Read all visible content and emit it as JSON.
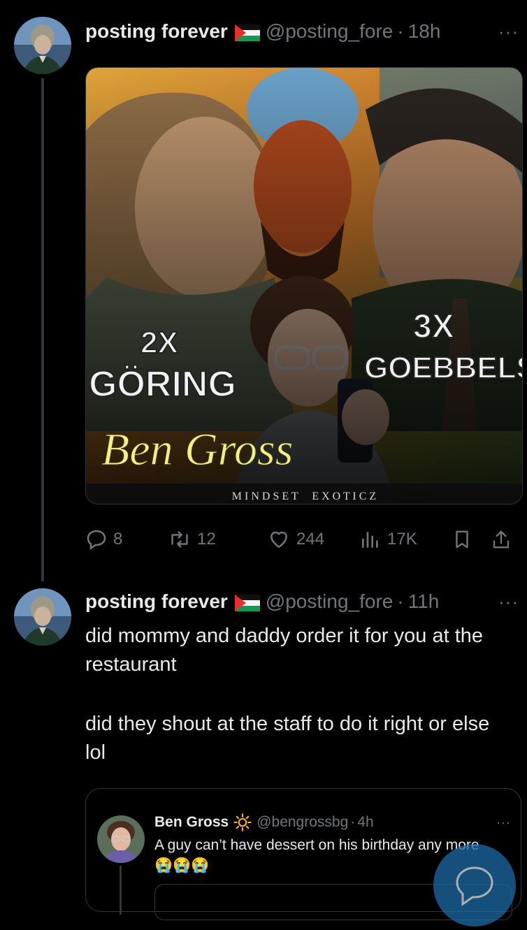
{
  "tweet1": {
    "author_name": "posting forever",
    "handle": "@posting_fore",
    "time": "18h",
    "more": "···",
    "image": {
      "label_left_count": "2X",
      "label_left_name": "GÖRING",
      "label_right_count": "3X",
      "label_right_name": "GOEBBELS",
      "script_title": "Ben Gross",
      "subtitle": "M I N D S E T     E X O T I C Z"
    },
    "actions": {
      "replies": "8",
      "reposts": "12",
      "likes": "244",
      "views": "17K"
    }
  },
  "tweet2": {
    "author_name": "posting forever",
    "handle": "@posting_fore",
    "time": "11h",
    "more": "···",
    "text_p1": "did mommy and daddy order it for you at the restaurant",
    "text_p2": "did they shout at the staff to do it right or else lol",
    "quote": {
      "author_name": "Ben Gross",
      "badge_icon": "sun-icon",
      "handle": "@bengrossbg",
      "time": "4h",
      "more": "···",
      "text": "A guy can’t have dessert on his birthday any more",
      "emoji": "😭😭😭"
    }
  },
  "colors": {
    "background": "#000000",
    "text_primary": "#e7e9ea",
    "text_secondary": "#71767b",
    "image_text_yellow": "#f3f08a",
    "fab": "#1d6aa6"
  }
}
